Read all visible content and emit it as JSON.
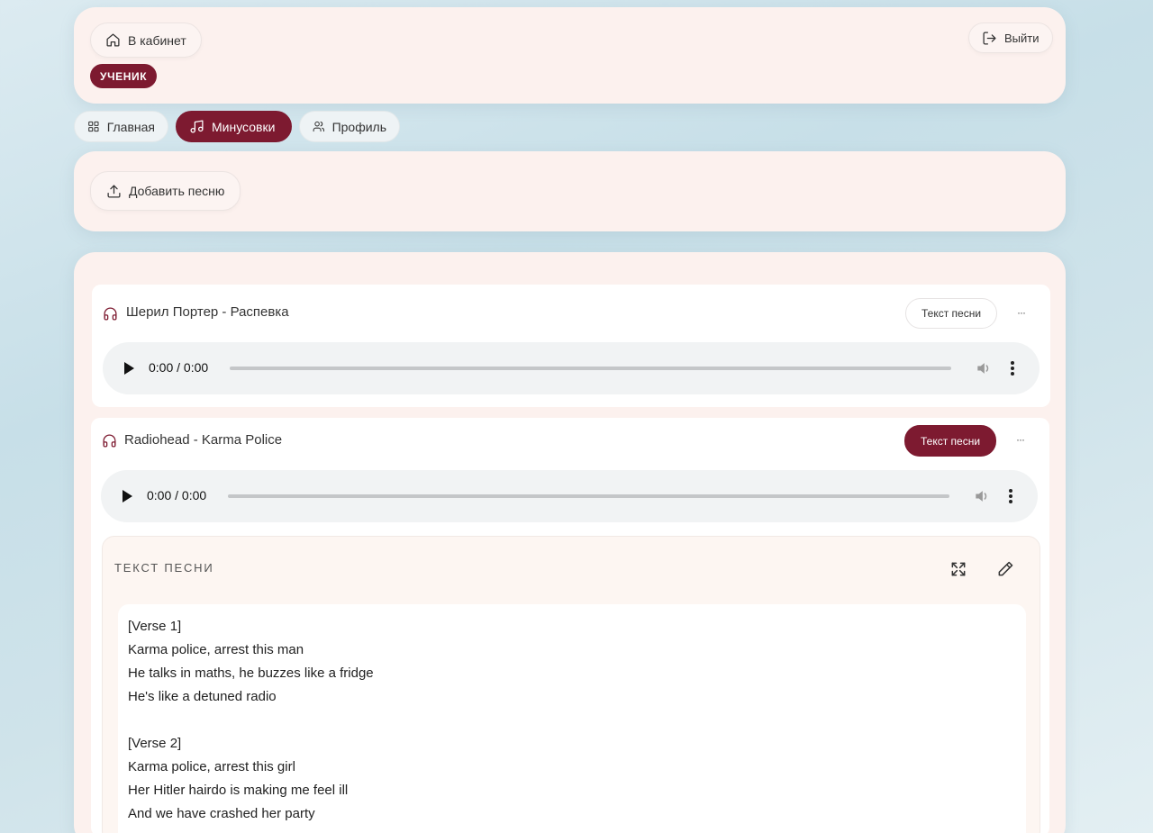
{
  "header": {
    "cabinet_button": "В кабинет",
    "logout_button": "Выйти",
    "role_badge": "УЧЕНИК"
  },
  "nav": {
    "tabs": [
      {
        "label": "Главная",
        "icon": "grid-icon",
        "active": false
      },
      {
        "label": "Минусовки",
        "icon": "music-note-icon",
        "active": true
      },
      {
        "label": "Профиль",
        "icon": "users-icon",
        "active": false
      }
    ]
  },
  "upload": {
    "add_song_button": "Добавить песню"
  },
  "songs": [
    {
      "title": "Шерил Портер - Распевка",
      "lyrics_button": "Текст песни",
      "lyrics_active": false,
      "more": "···",
      "player": {
        "time": "0:00 / 0:00"
      }
    },
    {
      "title": "Radiohead - Karma Police",
      "lyrics_button": "Текст песни",
      "lyrics_active": true,
      "more": "···",
      "player": {
        "time": "0:00 / 0:00"
      }
    }
  ],
  "lyrics": {
    "heading": "ТЕКСТ ПЕСНИ",
    "text": "[Verse 1]\nKarma police, arrest this man\nHe talks in maths, he buzzes like a fridge\nHe's like a detuned radio\n\n[Verse 2]\nKarma police, arrest this girl\nHer Hitler hairdo is making me feel ill\nAnd we have crashed her party"
  },
  "colors": {
    "accent": "#7d1a30",
    "card_bg": "#fcf1ee",
    "page_bg": "#cfe3ea",
    "player_bg": "#f1f3f4"
  }
}
